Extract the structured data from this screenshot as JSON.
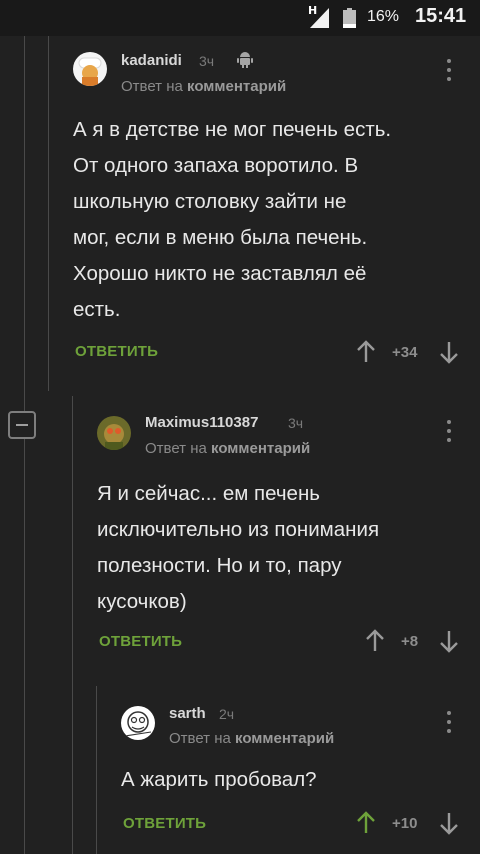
{
  "status_bar": {
    "network": "H",
    "battery": "16%",
    "time": "15:41"
  },
  "comments": [
    {
      "username": "kadanidi",
      "time": "3ч",
      "reply_prefix": "Ответ на",
      "reply_target": "комментарий",
      "text_lines": [
        "А я в детстве не мог печень есть.",
        "От одного запаха воротило. В",
        "школьную столовку зайти не",
        "мог, если в меню была печень.",
        "Хорошо никто не заставлял её",
        "есть."
      ],
      "reply_label": "ОТВЕТИТЬ",
      "rating": "+34",
      "platform_icon": "android-icon"
    },
    {
      "username": "Maximus110387",
      "time": "3ч",
      "reply_prefix": "Ответ на",
      "reply_target": "комментарий",
      "text_lines": [
        "Я и сейчас... ем печень",
        "исключительно из понимания",
        "полезности. Но и то, пару",
        "кусочков)"
      ],
      "reply_label": "ОТВЕТИТЬ",
      "rating": "+8"
    },
    {
      "username": "sarth",
      "time": "2ч",
      "reply_prefix": "Ответ на",
      "reply_target": "комментарий",
      "text_lines": [
        "А жарить пробовал?"
      ],
      "reply_label": "ОТВЕТИТЬ",
      "rating": "+10",
      "upvoted": true
    }
  ],
  "colors": {
    "background": "#212121",
    "accent_green": "#6ea23a",
    "muted": "#8a8a8a"
  }
}
